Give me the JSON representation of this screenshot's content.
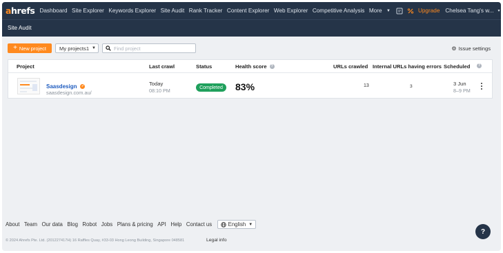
{
  "brand": {
    "logo_prefix": "a",
    "logo_rest": "hrefs",
    "accent": "#ff8a1f",
    "nav_bg": "#253448"
  },
  "topnav": {
    "items": [
      "Dashboard",
      "Site Explorer",
      "Keywords Explorer",
      "Site Audit",
      "Rank Tracker",
      "Content Explorer",
      "Web Explorer",
      "Competitive Analysis",
      "More"
    ],
    "upgrade": "Upgrade",
    "account": "Chelsea Tang's w..."
  },
  "subnav": {
    "title": "Site Audit"
  },
  "toolbar": {
    "new_project": "New project",
    "projects_dropdown": "My projects1",
    "search_placeholder": "Find project",
    "issue_settings": "Issue settings"
  },
  "table": {
    "headers": {
      "project": "Project",
      "last_crawl": "Last crawl",
      "status": "Status",
      "health_score": "Health score",
      "urls_crawled": "URLs crawled",
      "internal_errors": "Internal URLs having errors",
      "scheduled": "Scheduled"
    },
    "rows": [
      {
        "name": "Saasdesign",
        "url": "saasdesign.com.au/",
        "last_crawl_day": "Today",
        "last_crawl_time": "08:10 PM",
        "status": "Completed",
        "health_score": "83%",
        "urls_crawled": "13",
        "internal_errors": "3",
        "scheduled_date": "3 Jun",
        "scheduled_time": "8–9 PM"
      }
    ]
  },
  "footer": {
    "links": [
      "About",
      "Team",
      "Our data",
      "Blog",
      "Robot",
      "Jobs",
      "Plans & pricing",
      "API",
      "Help",
      "Contact us"
    ],
    "language": "English",
    "copyright": "© 2024 Ahrefs Pte. Ltd. (201227417H) 16 Raffles Quay, #33-03 Hong Leong Building, Singapore 048581",
    "legal": "Legal info",
    "help_button": "?"
  }
}
